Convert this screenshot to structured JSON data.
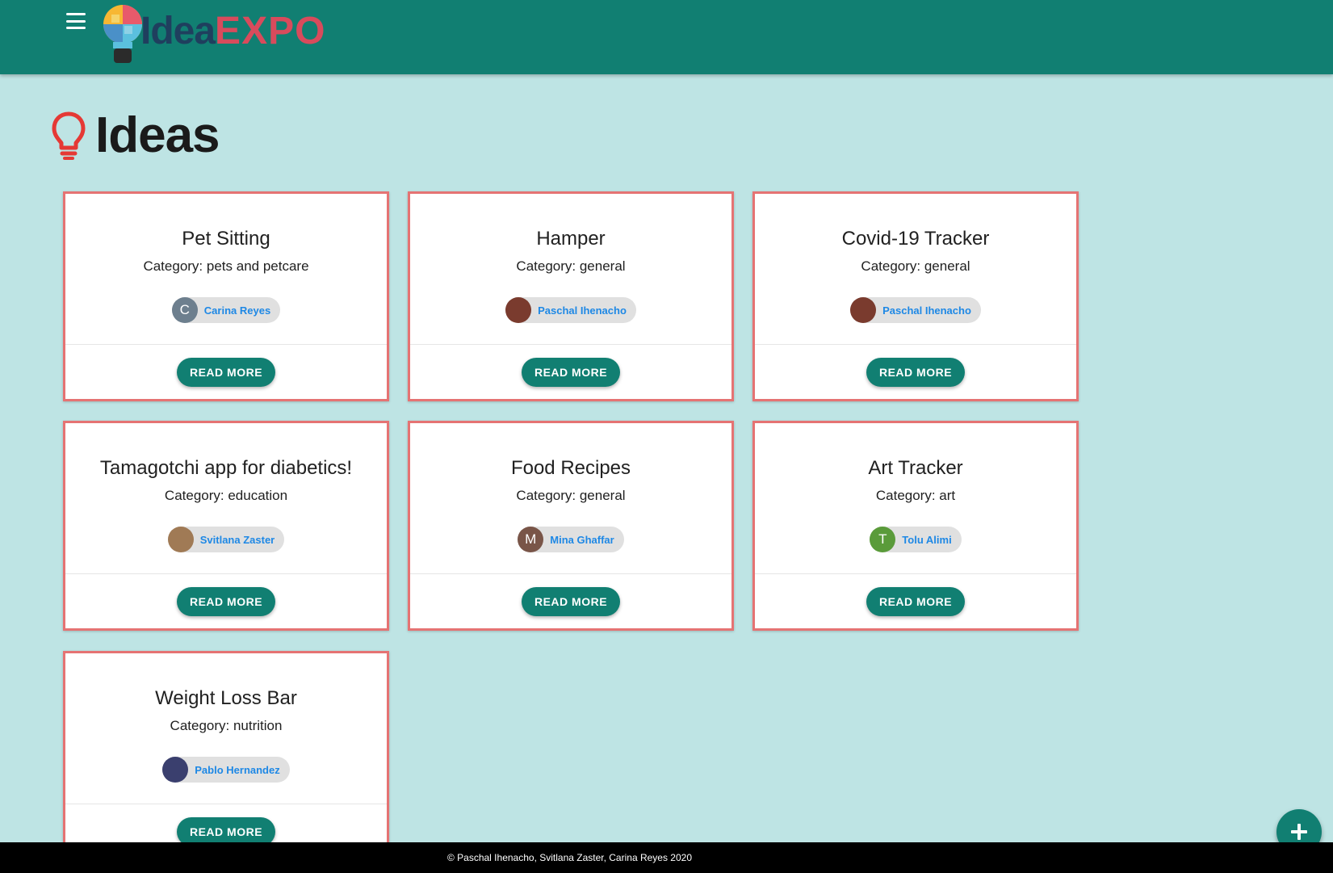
{
  "header": {
    "menu_icon": "menu-icon",
    "logo_text_idea": "Idea",
    "logo_text_expo": "EXPO",
    "background_color": "#117f72"
  },
  "page": {
    "title": "Ideas",
    "title_icon": "lightbulb-icon",
    "background_color": "#bee4e4"
  },
  "ideas": [
    {
      "title": "Pet Sitting",
      "category": "Category: pets and petcare",
      "author": "Carina Reyes",
      "avatar_letter": "C",
      "avatar_color": "#6d7f8e",
      "button": "READ MORE"
    },
    {
      "title": "Hamper",
      "category": "Category: general",
      "author": "Paschal Ihenacho",
      "avatar_letter": "",
      "avatar_color": "#7a3b2e",
      "button": "READ MORE"
    },
    {
      "title": "Covid-19 Tracker",
      "category": "Category: general",
      "author": "Paschal Ihenacho",
      "avatar_letter": "",
      "avatar_color": "#7a3b2e",
      "button": "READ MORE"
    },
    {
      "title": "Tamagotchi app for diabetics!",
      "category": "Category: education",
      "author": "Svitlana Zaster",
      "avatar_letter": "",
      "avatar_color": "#a07a55",
      "button": "READ MORE"
    },
    {
      "title": "Food Recipes",
      "category": "Category: general",
      "author": "Mina Ghaffar",
      "avatar_letter": "M",
      "avatar_color": "#795548",
      "button": "READ MORE"
    },
    {
      "title": "Art Tracker",
      "category": "Category: art",
      "author": "Tolu Alimi",
      "avatar_letter": "T",
      "avatar_color": "#5a9b3a",
      "button": "READ MORE"
    },
    {
      "title": "Weight Loss Bar",
      "category": "Category: nutrition",
      "author": "Pablo Hernandez",
      "avatar_letter": "",
      "avatar_color": "#3a3f6e",
      "button": "READ MORE"
    }
  ],
  "fab": {
    "icon": "plus-icon"
  },
  "footer": {
    "text": "© Paschal Ihenacho, Svitlana Zaster, Carina Reyes 2020"
  }
}
